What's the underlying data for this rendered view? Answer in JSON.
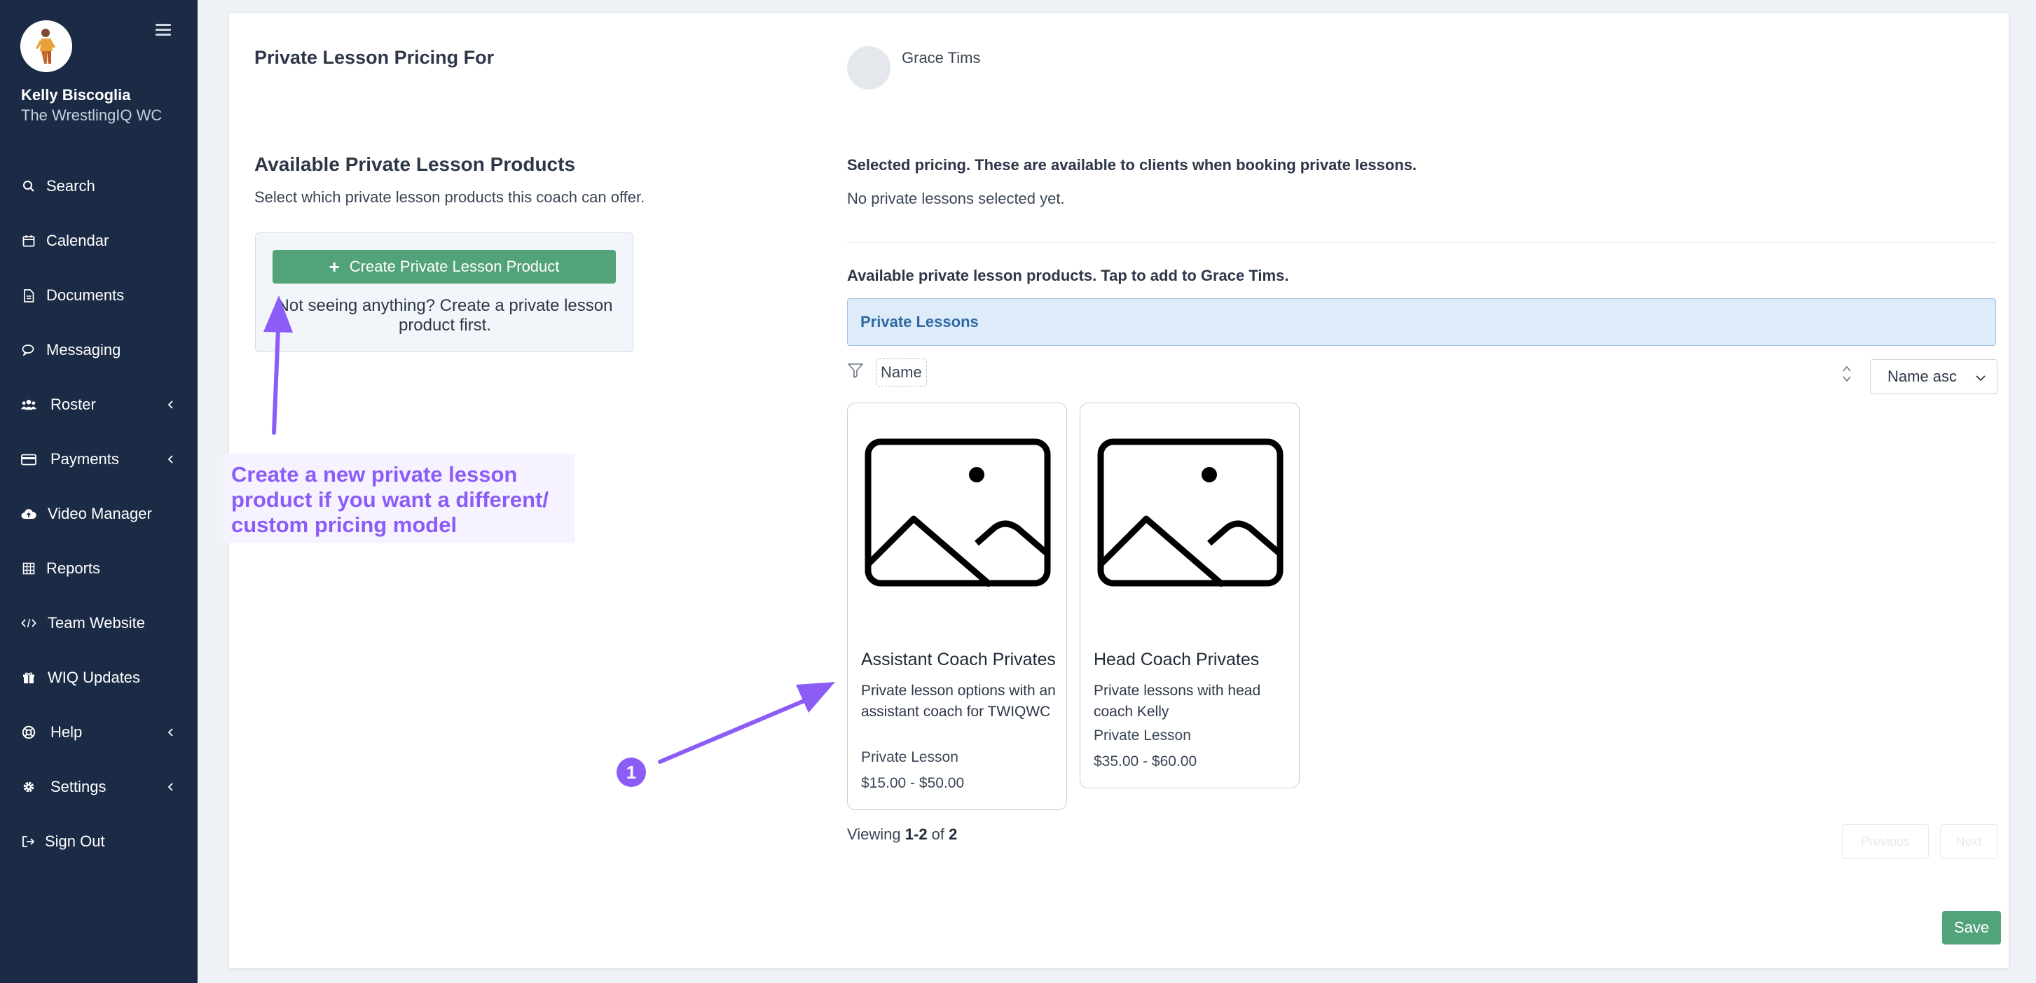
{
  "sidebar": {
    "user_name": "Kelly Biscoglia",
    "team_name": "The WrestlingIQ WC",
    "items": [
      {
        "label": "Search",
        "icon": "search-icon",
        "has_chevron": false
      },
      {
        "label": "Calendar",
        "icon": "calendar-icon",
        "has_chevron": false
      },
      {
        "label": "Documents",
        "icon": "document-icon",
        "has_chevron": false
      },
      {
        "label": "Messaging",
        "icon": "chat-icon",
        "has_chevron": false
      },
      {
        "label": "Roster",
        "icon": "users-icon",
        "has_chevron": true
      },
      {
        "label": "Payments",
        "icon": "credit-card-icon",
        "has_chevron": true
      },
      {
        "label": "Video Manager",
        "icon": "cloud-upload-icon",
        "has_chevron": false
      },
      {
        "label": "Reports",
        "icon": "table-icon",
        "has_chevron": false
      },
      {
        "label": "Team Website",
        "icon": "code-icon",
        "has_chevron": false
      },
      {
        "label": "WIQ Updates",
        "icon": "gift-icon",
        "has_chevron": false
      },
      {
        "label": "Help",
        "icon": "lifebuoy-icon",
        "has_chevron": true
      },
      {
        "label": "Settings",
        "icon": "gear-icon",
        "has_chevron": true
      },
      {
        "label": "Sign Out",
        "icon": "sign-out-icon",
        "has_chevron": false
      }
    ]
  },
  "main": {
    "page_title": "Private Lesson Pricing For",
    "coach_name": "Grace Tims",
    "products_section": {
      "title": "Available Private Lesson Products",
      "subtitle": "Select which private lesson products this coach can offer.",
      "create_button": "Create Private Lesson Product",
      "create_hint": "Not seeing anything? Create a private lesson product first."
    },
    "selected": {
      "title": "Selected pricing. These are available to clients when booking private lessons.",
      "empty": "No private lessons selected yet."
    },
    "available": {
      "title": "Available private lesson products. Tap to add to Grace Tims.",
      "category": "Private Lessons",
      "filter_placeholder": "Name",
      "sort_value": "Name asc"
    },
    "products": [
      {
        "name": "Assistant Coach Privates",
        "description": "Private lesson options with an assistant coach for TWIQWC",
        "type": "Private Lesson",
        "price": "$15.00 - $50.00"
      },
      {
        "name": "Head Coach Privates",
        "description": "Private lessons with head coach Kelly",
        "type": "Private Lesson",
        "price": "$35.00 - $60.00"
      }
    ],
    "pagination": {
      "prefix": "Viewing ",
      "range": "1-2",
      "of": " of ",
      "total": "2",
      "prev_label": "Previous",
      "next_label": "Next"
    },
    "save_button": "Save"
  },
  "annotations": {
    "callout_text": "Create a new private lesson product if you want a different/ custom pricing model",
    "step_number": "1",
    "accent_color": "#8b5cf6"
  }
}
